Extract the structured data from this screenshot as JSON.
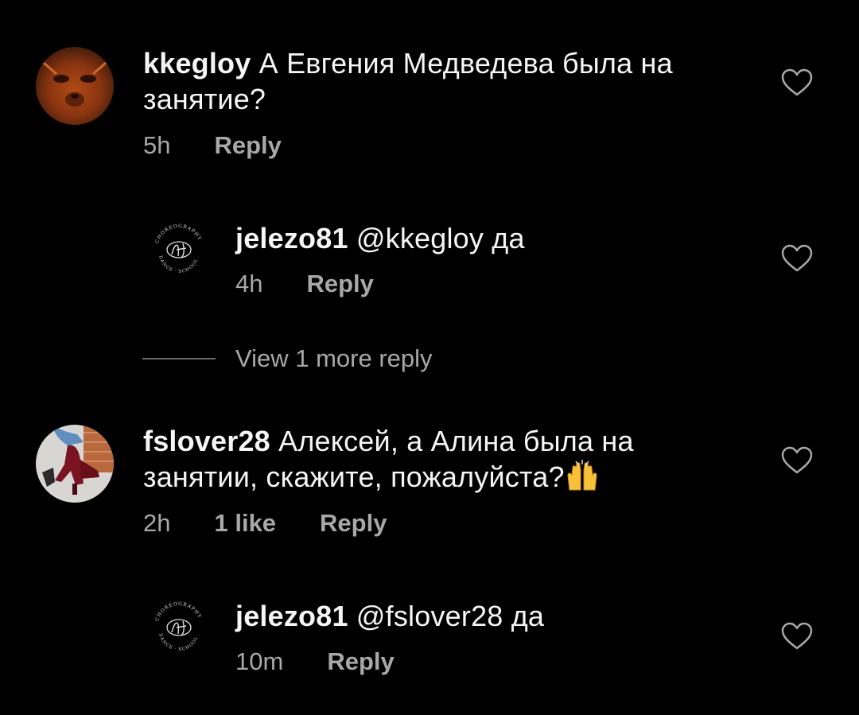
{
  "comments": [
    {
      "username": "kkegloy",
      "text_line1": "А Евгения Медведева была на",
      "text_line2": "занятие?",
      "time": "5h",
      "reply_label": "Reply",
      "avatar": "fox-face-avatar",
      "heart_icon": "heart-outline-icon"
    },
    {
      "username": "jelezo81",
      "text": "@kkegloy да",
      "time": "4h",
      "reply_label": "Reply",
      "avatar": "dance-choreography-school-logo",
      "heart_icon": "heart-outline-icon"
    },
    {
      "username": "fslover28",
      "text_line1": "Алексей, а Алина была на",
      "text_line2": "занятии, скажите, пожалуйста?",
      "time": "2h",
      "likes": "1 like",
      "reply_label": "Reply",
      "avatar": "red-boots-avatar",
      "emoji": "raising-hands-emoji",
      "heart_icon": "heart-outline-icon"
    },
    {
      "username": "jelezo81",
      "text": "@fslover28 да",
      "time": "10m",
      "reply_label": "Reply",
      "avatar": "dance-choreography-school-logo",
      "heart_icon": "heart-outline-icon"
    }
  ],
  "view_more": {
    "label": "View 1 more reply"
  },
  "logo_text": "DANCE & CHOREOGRAPHY SCHOOL",
  "colors": {
    "background": "#000000",
    "primary_text": "#f5f5f5",
    "secondary_text": "#a8a8a8"
  }
}
